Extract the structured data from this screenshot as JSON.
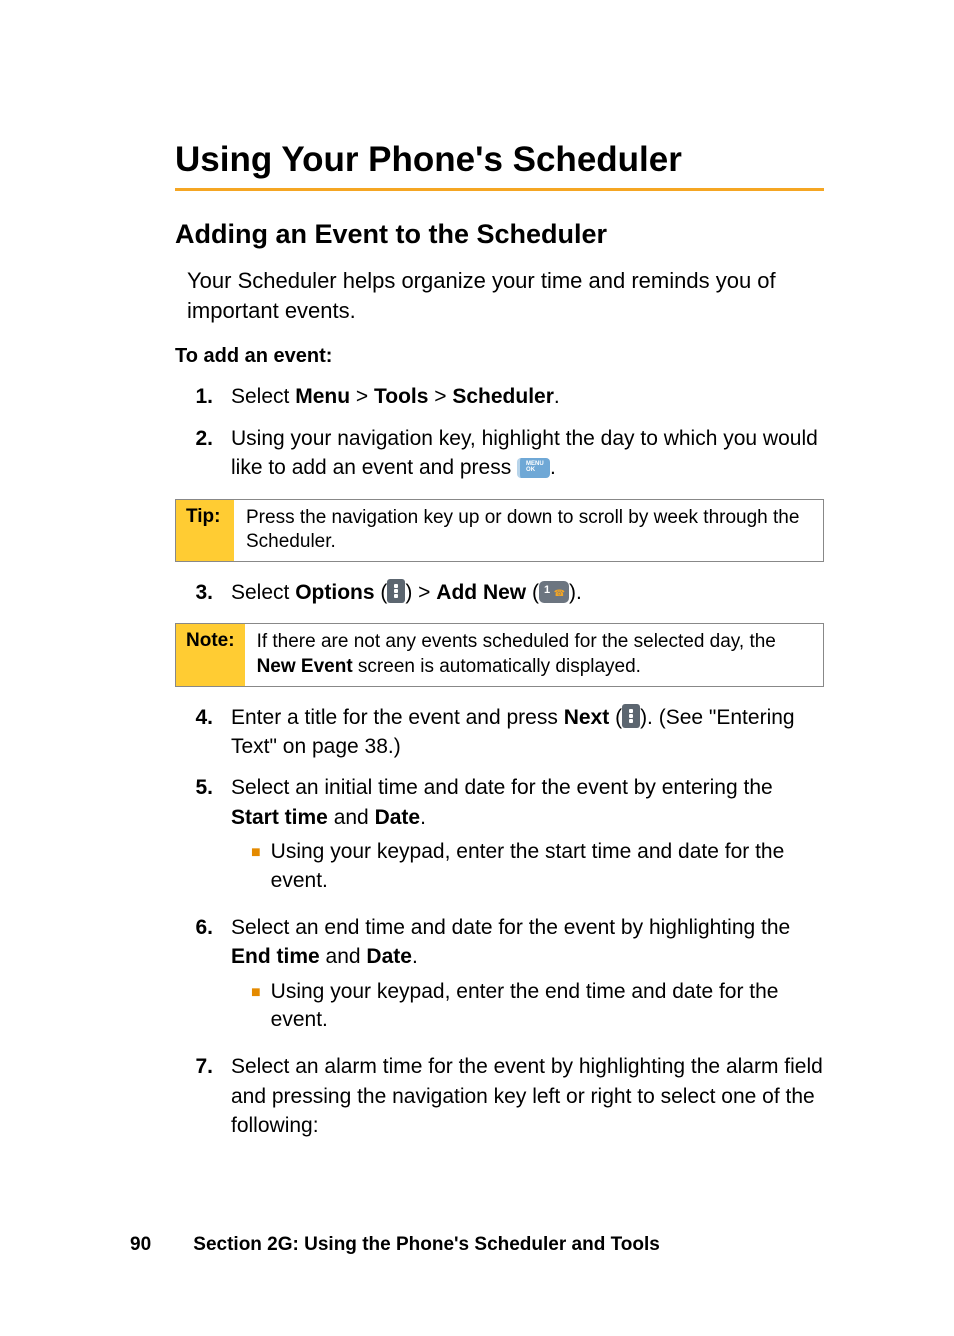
{
  "h1": "Using Your Phone's Scheduler",
  "h2": "Adding an Event to the Scheduler",
  "intro": "Your Scheduler helps organize your time and reminds you of important events.",
  "subhead": "To add an event:",
  "steps": {
    "s1": {
      "num": "1.",
      "prefix": "Select ",
      "b1": "Menu",
      "sep1": " > ",
      "b2": "Tools",
      "sep2": " > ",
      "b3": "Scheduler",
      "suffix": "."
    },
    "s2": {
      "num": "2.",
      "text_a": "Using your navigation key, highlight the day to which you would like to add an event and press ",
      "text_b": "."
    },
    "s3": {
      "num": "3.",
      "prefix": "Select ",
      "b1": "Options",
      "mid": " (",
      "close1": ") > ",
      "b2": "Add New",
      "open2": " (",
      "close2": ")."
    },
    "s4": {
      "num": "4.",
      "prefix": "Enter a title for the event and press ",
      "b1": "Next",
      "open": " (",
      "close": "). (See \"Entering Text\" on page 38.)"
    },
    "s5": {
      "num": "5.",
      "prefix": "Select an initial time and date for the event by entering the ",
      "b1": "Start time",
      "mid": " and ",
      "b2": "Date",
      "suffix": ".",
      "sub": "Using your keypad, enter the start time and date for the event."
    },
    "s6": {
      "num": "6.",
      "prefix": "Select an end time and date for the event by highlighting the ",
      "b1": "End time",
      "mid": " and ",
      "b2": "Date",
      "suffix": ".",
      "sub": "Using your keypad, enter the end time and date for the event."
    },
    "s7": {
      "num": "7.",
      "text": "Select an alarm time for the event by highlighting the alarm field and pressing the navigation key left or right to select one of the following:"
    }
  },
  "tip": {
    "label": "Tip:",
    "text": "Press the navigation key up or down to scroll by week through the Scheduler."
  },
  "note": {
    "label": "Note:",
    "text_a": "If there are not any events scheduled for the selected day, the ",
    "bold": "New Event",
    "text_b": " screen is automatically displayed."
  },
  "footer": {
    "page": "90",
    "text": "Section 2G: Using the Phone's Scheduler and Tools"
  }
}
